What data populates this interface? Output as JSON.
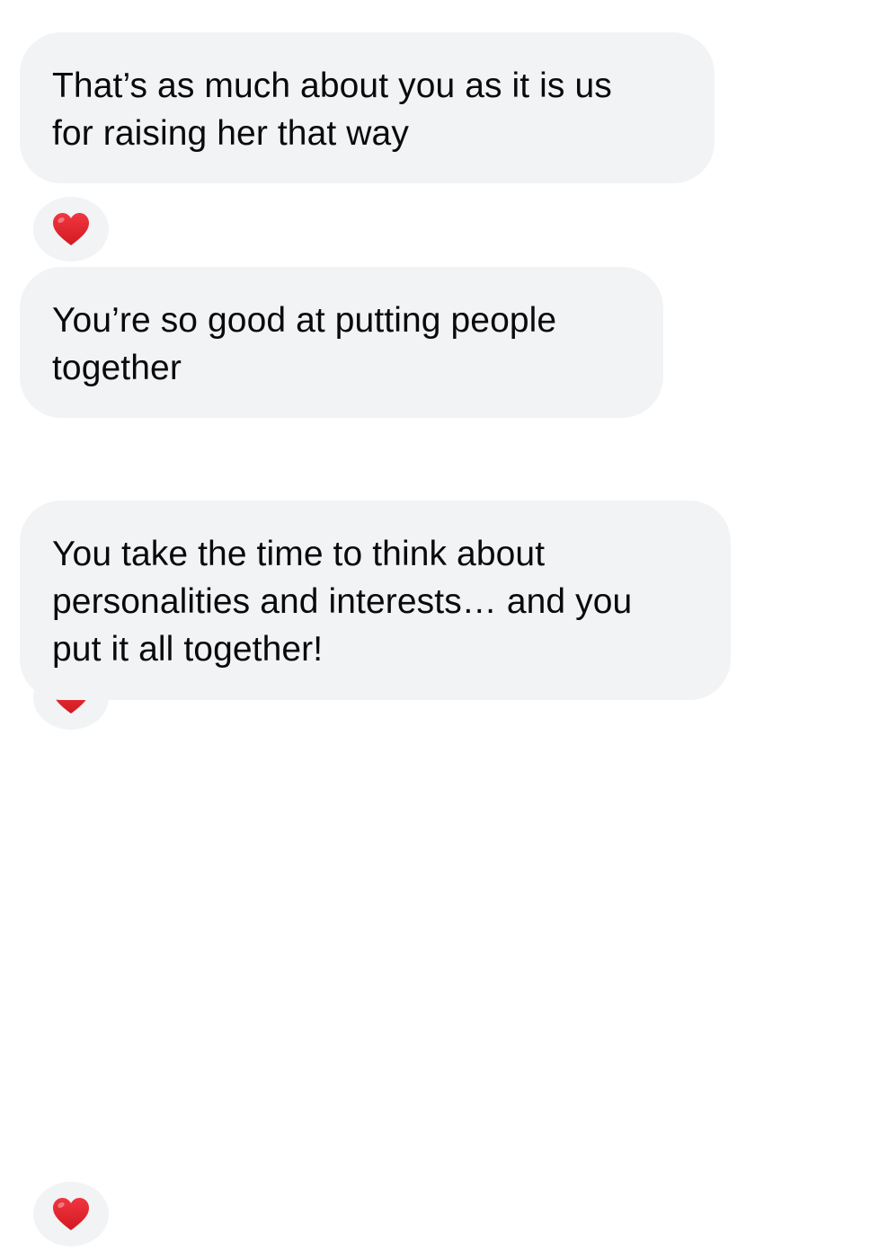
{
  "messages": [
    {
      "text": "That’s as much about you as it is us\nfor raising her that way",
      "reaction": "red-heart"
    },
    {
      "text": "You’re so good at putting people\ntogether",
      "reaction": "red-heart"
    },
    {
      "text": "You take the time to think about\npersonalities and interests… and you\nput it all together!",
      "reaction": "red-heart"
    }
  ],
  "colors": {
    "bubble_background": "#f1f3f5",
    "text": "#0a0a0a",
    "heart": "#e0242e",
    "page_background": "#ffffff"
  }
}
